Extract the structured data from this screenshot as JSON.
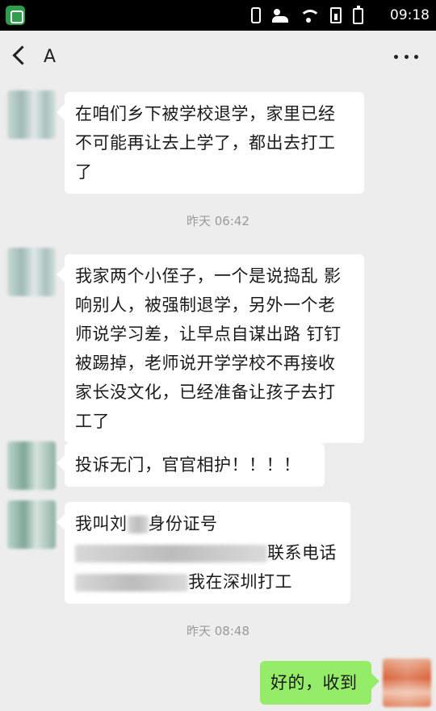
{
  "status_bar": {
    "time": "09:18"
  },
  "nav": {
    "title": "A"
  },
  "messages": [
    {
      "lines": [
        "在咱们乡下被学校退学，家里已经",
        "不可能再让去上学了，都出去打工",
        "了"
      ]
    },
    {
      "lines": [
        "我家两个小侄子，一个是说捣乱 影",
        "响别人，被强制退学，另外一个老",
        "师说学习差，让早点自谋出路 钉钉",
        "被踢掉，老师说开学学校不再接收",
        "家长没文化，已经准备让孩子去打",
        "工了"
      ]
    },
    {
      "lines": [
        "投诉无门，官官相护！！！！"
      ]
    },
    {
      "line1_a": "我叫刘",
      "line1_b": "身份证号",
      "line2": "联系电话",
      "line3": "我在深圳打工"
    },
    {
      "lines": [
        "好的，收到"
      ]
    }
  ],
  "timestamps": [
    "昨天 06:42",
    "昨天 08:48"
  ],
  "colors": {
    "background": "#ededed",
    "bubble": "#ffffff",
    "my_bubble": "#95ec69",
    "statusbar": "#000000"
  }
}
